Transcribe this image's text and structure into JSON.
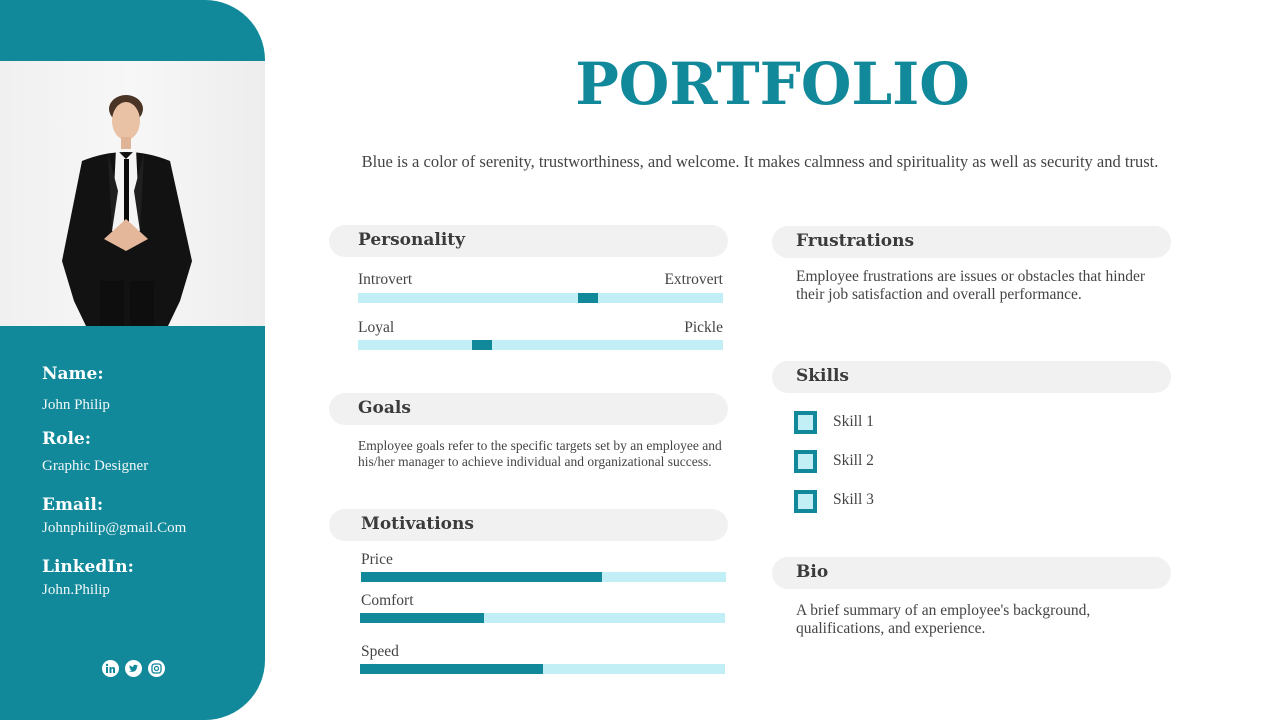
{
  "colors": {
    "accent": "#11899a",
    "track": "#c2eff5",
    "pill": "#f1f1f1"
  },
  "title": "PORTFOLIO",
  "subtitle": "Blue is a color of serenity, trustworthiness, and welcome. It makes calmness and spirituality  as well as security and trust.",
  "profile": {
    "photo_alt": "Man in black suit",
    "fields": [
      {
        "label": "Name:",
        "value": "John Philip"
      },
      {
        "label": "Role:",
        "value": "Graphic Designer"
      },
      {
        "label": "Email:",
        "value": "Johnphilip@gmail.Com"
      },
      {
        "label": "LinkedIn:",
        "value": "John.Philip"
      }
    ],
    "social": [
      "linkedin-icon",
      "twitter-icon",
      "instagram-icon"
    ]
  },
  "personality": {
    "heading": "Personality",
    "scales": [
      {
        "left": "Introvert",
        "right": "Extrovert",
        "position": 0.63
      },
      {
        "left": "Loyal",
        "right": "Pickle",
        "position": 0.34
      }
    ]
  },
  "goals": {
    "heading": "Goals",
    "text": "Employee goals refer to the specific targets set by an employee and his/her manager to achieve individual and organizational success."
  },
  "motivations": {
    "heading": "Motivations",
    "items": [
      {
        "label": "Price",
        "value": 0.66
      },
      {
        "label": "Comfort",
        "value": 0.34
      },
      {
        "label": "Speed",
        "value": 0.5
      }
    ]
  },
  "frustrations": {
    "heading": "Frustrations",
    "text": "Employee frustrations are issues or obstacles that hinder their job satisfaction and overall performance."
  },
  "skills": {
    "heading": "Skills",
    "items": [
      "Skill 1",
      "Skill 2",
      "Skill 3"
    ]
  },
  "bio": {
    "heading": "Bio",
    "text": "A brief summary of an employee's background, qualifications, and experience."
  }
}
